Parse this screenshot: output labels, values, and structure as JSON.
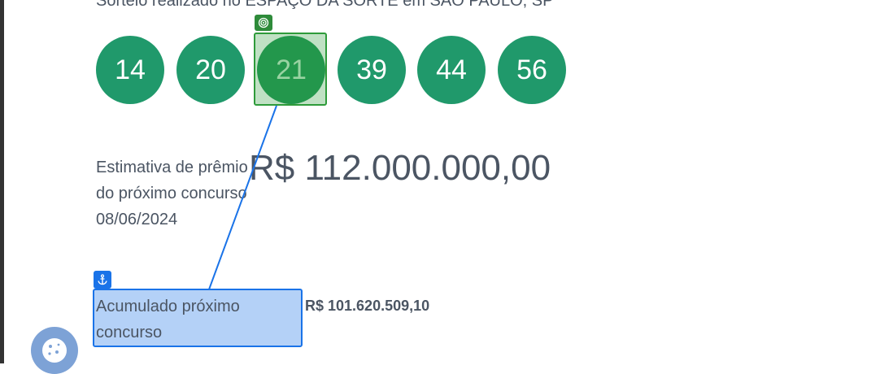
{
  "draw": {
    "location_text": "Sorteio realizado no ESPAÇO DA SORTE em SÃO PAULO, SP",
    "numbers": [
      "14",
      "20",
      "21",
      "39",
      "44",
      "56"
    ]
  },
  "estimate": {
    "label": "Estimativa de prêmio do próximo concurso 08/06/2024",
    "value": "R$ 112.000.000,00"
  },
  "accumulated": {
    "label": "Acumulado próximo concurso",
    "value": "R$ 101.620.509,10"
  },
  "overlay": {
    "target_icon": "target-icon",
    "anchor_icon": "anchor-icon",
    "highlight_color": "#2e9b3a",
    "anchor_color": "#1a73e8"
  },
  "cookie": {
    "icon": "cookie-icon"
  }
}
